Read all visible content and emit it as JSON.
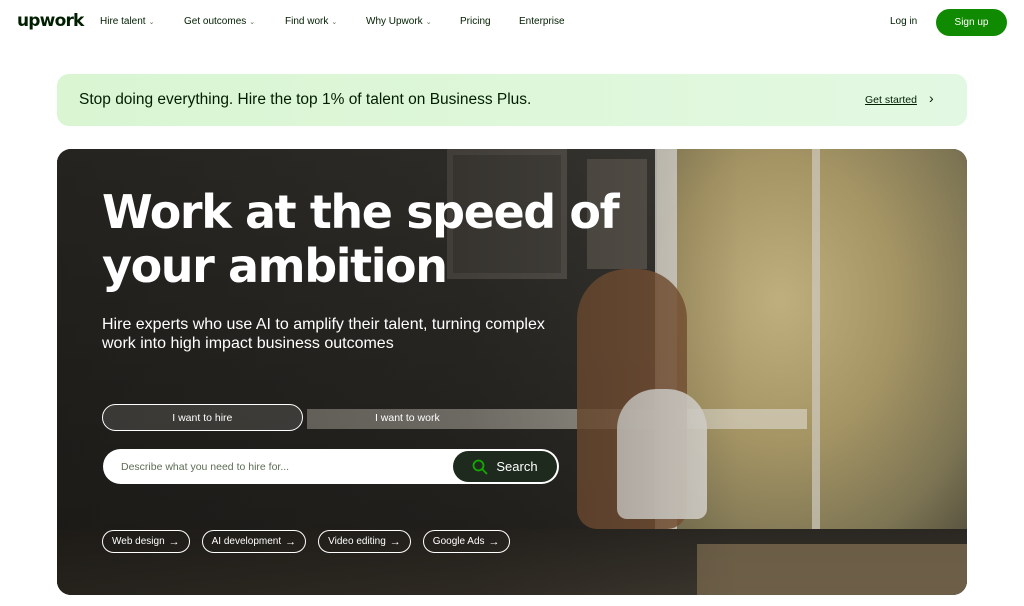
{
  "nav": {
    "logo": "upwork",
    "items": [
      {
        "label": "Hire talent",
        "dropdown": true
      },
      {
        "label": "Get outcomes",
        "dropdown": true
      },
      {
        "label": "Find work",
        "dropdown": true
      },
      {
        "label": "Why Upwork",
        "dropdown": true
      },
      {
        "label": "Pricing",
        "dropdown": false
      },
      {
        "label": "Enterprise",
        "dropdown": false
      }
    ],
    "login": "Log in",
    "signup": "Sign up"
  },
  "promo": {
    "text": "Stop doing everything. Hire the top 1% of talent on Business Plus.",
    "cta": "Get started",
    "arrow": "›"
  },
  "hero": {
    "title": "Work at the speed of your ambition",
    "subtitle": "Hire experts who use AI to amplify their talent, turning complex work into high impact business outcomes",
    "toggle": {
      "hire": "I want to hire",
      "work": "I want to work",
      "active": "hire"
    },
    "search": {
      "placeholder": "Describe what you need to hire for...",
      "value": "",
      "button": "Search"
    },
    "chips": [
      {
        "label": "Web design"
      },
      {
        "label": "AI development"
      },
      {
        "label": "Video editing"
      },
      {
        "label": "Google Ads"
      }
    ],
    "chip_arrow": "→"
  },
  "colors": {
    "brand_green": "#108a00",
    "text_dark": "#001e00",
    "promo_bg": "#d9f5d2",
    "search_button": "#1e2a1e"
  }
}
